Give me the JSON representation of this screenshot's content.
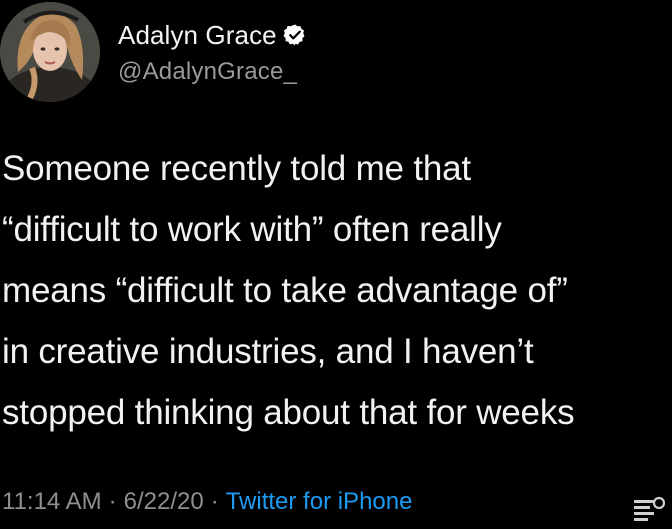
{
  "author": {
    "display_name": "Adalyn Grace",
    "handle": "@AdalynGrace_",
    "verified_icon": "verified-badge-icon",
    "avatar_icon": "profile-photo"
  },
  "tweet": {
    "lines": [
      "Someone recently told me that",
      "“difficult to work with” often really",
      "means “difficult to take advantage of”",
      "in creative industries, and I haven’t",
      "stopped thinking about that for weeks"
    ],
    "time": "11:14 AM",
    "date": "6/22/20",
    "separator": "·",
    "source": "Twitter for iPhone"
  },
  "colors": {
    "background": "#000000",
    "text": "#f2f2f2",
    "secondary": "#8f8f8f",
    "link": "#1d9bf0"
  }
}
